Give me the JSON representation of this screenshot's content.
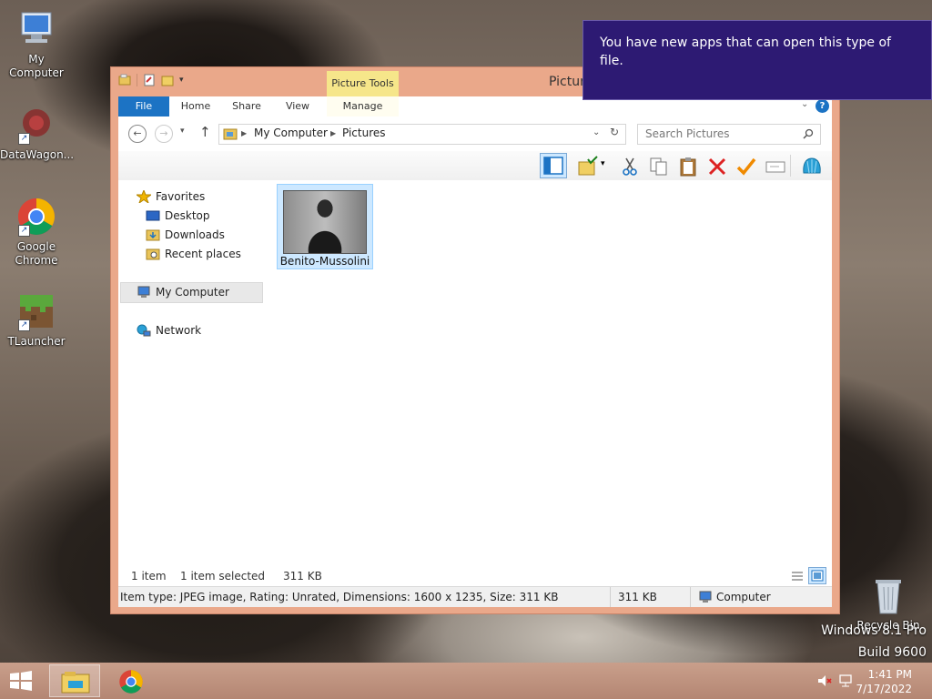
{
  "desktop": {
    "icons": [
      {
        "label": "My Computer"
      },
      {
        "label": "DataWagon..."
      },
      {
        "label": "Google\nChrome"
      },
      {
        "label": "TLauncher"
      },
      {
        "label": "Recycle Bin"
      }
    ],
    "watermark": {
      "line1": "Windows 8.1 Pro",
      "line2": "Build 9600"
    }
  },
  "toast": {
    "message": "You have new apps that can open this type of file."
  },
  "window": {
    "title": "Pictur",
    "contextual_tab_group": "Picture Tools",
    "ribbon_tabs": [
      {
        "label": "File"
      },
      {
        "label": "Home"
      },
      {
        "label": "Share"
      },
      {
        "label": "View"
      },
      {
        "label": "Manage"
      }
    ],
    "address": {
      "crumbs": [
        "My Computer",
        "Pictures"
      ]
    },
    "search": {
      "placeholder": "Search Pictures"
    },
    "nav_pane": {
      "favorites": "Favorites",
      "favorites_items": [
        "Desktop",
        "Downloads",
        "Recent places"
      ],
      "computer": "My Computer",
      "network": "Network"
    },
    "files": [
      {
        "name": "Benito-Mussolini"
      }
    ],
    "status": {
      "count": "1 item",
      "selected": "1 item selected",
      "size": "311 KB"
    },
    "details": {
      "text": "Item type: JPEG image, Rating: Unrated, Dimensions: 1600 x 1235, Size: 311 KB",
      "size": "311 KB",
      "location": "Computer"
    }
  },
  "taskbar": {
    "time": "1:41 PM",
    "date": "7/17/2022"
  },
  "colors": {
    "accent": "#1c73c4",
    "window_frame": "#eaa88a",
    "toast": "#2d1a73"
  }
}
